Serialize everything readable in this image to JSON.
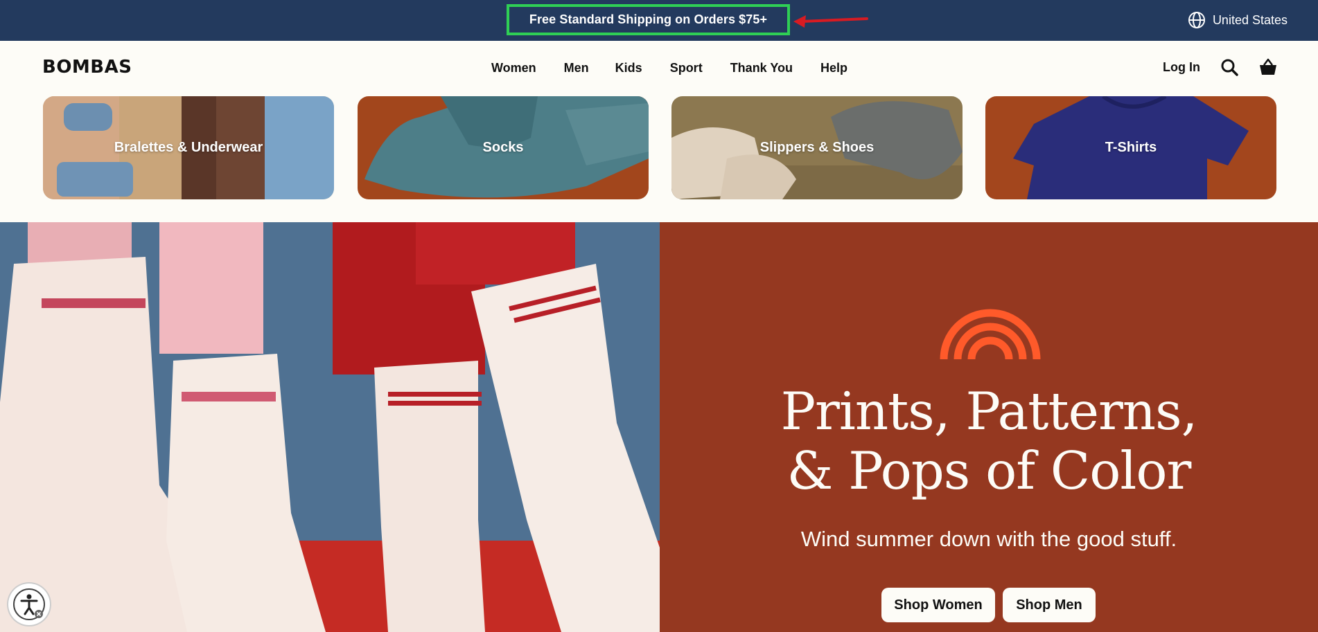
{
  "announcement": {
    "text": "Free Standard Shipping on Orders $75+",
    "highlight_color": "#2fcf55",
    "arrow_color": "#d81b22"
  },
  "region": {
    "label": "United States",
    "icon": "globe-icon"
  },
  "header": {
    "logo": "BOMBAS",
    "nav": [
      "Women",
      "Men",
      "Kids",
      "Sport",
      "Thank You",
      "Help"
    ],
    "login_label": "Log In",
    "search_icon": "search-icon",
    "cart_icon": "basket-icon"
  },
  "categories": [
    {
      "label": "Bralettes & Underwear"
    },
    {
      "label": "Socks"
    },
    {
      "label": "Slippers & Shoes"
    },
    {
      "label": "T-Shirts"
    }
  ],
  "hero": {
    "title_line1": "Prints, Patterns,",
    "title_line2": "& Pops of Color",
    "subtitle": "Wind summer down with the good stuff.",
    "cta_women": "Shop Women",
    "cta_men": "Shop Men",
    "bg_color": "#953820",
    "accent_color": "#ff5a2a"
  },
  "accessibility": {
    "icon": "accessibility-icon"
  }
}
